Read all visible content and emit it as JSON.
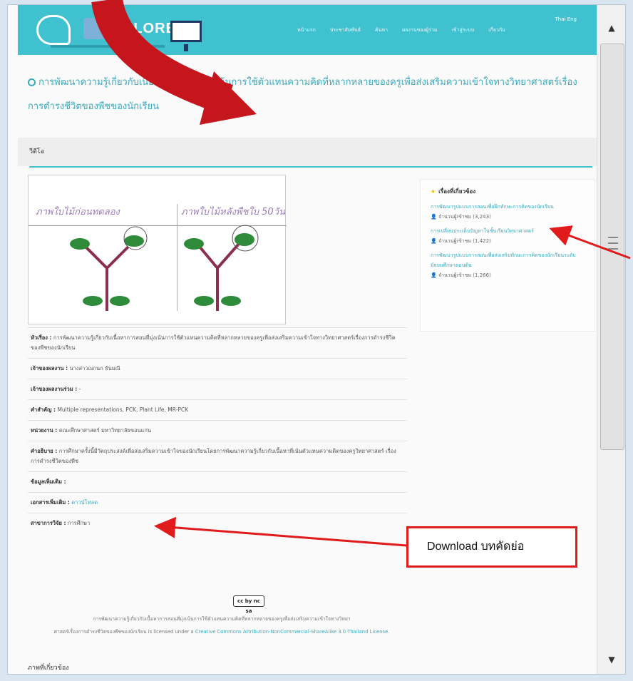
{
  "header": {
    "logo_text": "PLORE",
    "nav": [
      "หน้าแรก",
      "ประชาสัมพันธ์",
      "ค้นหา",
      "ผลงานของผู้ร่วม",
      "เข้าสู่ระบบ",
      "เกี่ยวกับ"
    ],
    "lang": "Thai Eng"
  },
  "page": {
    "title": "การพัฒนาความรู้เกี่ยวกับเนื้อหาการสอนที่มุ่งเน้นการใช้ตัวแทนความคิดที่หลากหลายของครูเพื่อส่งเสริมความเข้าใจทางวิทยาศาสตร์เรื่องการดำรงชีวิตของพืชของนักเรียน",
    "video_heading": "วีดีโอ",
    "video_captions": [
      "ภาพใบไม้ก่อนทดลอง",
      "ภาพใบไม้หลังพืชใบ 50วัน"
    ]
  },
  "sidebar": {
    "heading": "เรื่องที่เกี่ยวข้อง",
    "items": [
      {
        "title": "การพัฒนารูปแบบการสอนเพื่อฝึกทักษะการคิดของนักเรียน",
        "meta": "จำนวนผู้เข้าชม (3,243)"
      },
      {
        "title": "การเปลี่ยนประเด็นปัญหาในชั้นเรียนวิทยาศาสตร์",
        "meta": "จำนวนผู้เข้าชม (1,422)"
      },
      {
        "title": "การพัฒนารูปแบบการสอนเพื่อส่งเสริมทักษะการคิดของนักเรียนระดับมัธยมศึกษาตอนต้น",
        "meta": "จำนวนผู้เข้าชม (1,266)"
      }
    ]
  },
  "details": [
    {
      "label": "หัวเรื่อง :",
      "value": "การพัฒนาความรู้เกี่ยวกับเนื้อหาการสอนที่มุ่งเน้นการใช้ตัวแทนความคิดที่หลากหลายของครูเพื่อส่งเสริมความเข้าใจทางวิทยาศาสตร์เรื่องการดำรงชีวิตของพืชของนักเรียน"
    },
    {
      "label": "เจ้าของผลงาน :",
      "value": "นางสาวณกนก ธันมณี"
    },
    {
      "label": "เจ้าของผลงานร่วม :",
      "value": "-"
    },
    {
      "label": "คำสำคัญ :",
      "value": "Multiple representations, PCK, Plant Life, MR-PCK"
    },
    {
      "label": "หน่วยงาน :",
      "value": "คณะศึกษาศาสตร์ มหาวิทยาลัยขอนแก่น"
    },
    {
      "label": "คำอธิบาย :",
      "value": "การศึกษาครั้งนี้มีวัตถุประสงค์เพื่อส่งเสริมความเข้าใจของนักเรียนโดยการพัฒนาความรู้เกี่ยวกับเนื้อหาที่เน้นตัวแทนความคิดของครูวิทยาศาสตร์ เรื่อง การดำรงชีวิตของพืช"
    },
    {
      "label": "ข้อมูลเพิ่มเติม :",
      "value": ""
    },
    {
      "label": "เอกสารเพิ่มเติม :",
      "value": "ดาวน์โหลด",
      "is_link": true
    },
    {
      "label": "สาขาการวิจัย :",
      "value": "การศึกษา"
    }
  ],
  "license": {
    "badge": "cc by nc sa",
    "line1": "การพัฒนาความรู้เกี่ยวกับเนื้อหาการสอนที่มุ่งเน้นการใช้ตัวแทนความคิดที่หลากหลายของครูเพื่อส่งเสริมความเข้าใจทางวิทยา",
    "line2": "ศาสตร์เรื่องการดำรงชีวิตของพืชของนักเรียน is licensed under a",
    "link": "Creative Commons Attribution-NonCommercial-ShareAlike 3.0 Thailand License."
  },
  "related_images": "ภาพที่เกี่ยวข้อง",
  "callout": "Download บทคัดย่อ",
  "colors": {
    "teal": "#3fc1cf",
    "red": "#e11b1b",
    "link": "#3aaabd"
  }
}
